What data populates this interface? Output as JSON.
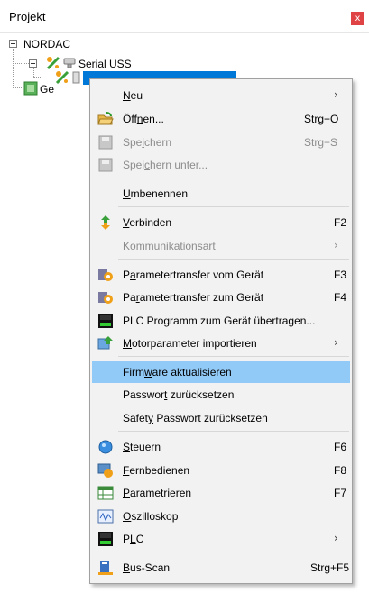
{
  "panel": {
    "title": "Projekt",
    "close_glyph": "x"
  },
  "tree": {
    "root": "NORDAC",
    "child1": "Serial USS",
    "child2": "Ge"
  },
  "menu": {
    "items": [
      {
        "pre": "",
        "u": "N",
        "post": "eu",
        "shortcut": "",
        "submenu": true,
        "disabled": false,
        "icon": ""
      },
      {
        "pre": "Öff",
        "u": "n",
        "post": "en...",
        "shortcut": "Strg+O",
        "submenu": false,
        "disabled": false,
        "icon": "folder-open-icon"
      },
      {
        "pre": "Spe",
        "u": "i",
        "post": "chern",
        "shortcut": "Strg+S",
        "submenu": false,
        "disabled": true,
        "icon": "save-icon"
      },
      {
        "pre": "Spei",
        "u": "c",
        "post": "hern unter...",
        "shortcut": "",
        "submenu": false,
        "disabled": true,
        "icon": "save-as-icon"
      },
      {
        "pre": "",
        "u": "U",
        "post": "mbenennen",
        "shortcut": "",
        "submenu": false,
        "disabled": false,
        "icon": ""
      },
      {
        "pre": "",
        "u": "V",
        "post": "erbinden",
        "shortcut": "F2",
        "submenu": false,
        "disabled": false,
        "icon": "connect-icon"
      },
      {
        "pre": "",
        "u": "K",
        "post": "ommunikationsart",
        "shortcut": "",
        "submenu": true,
        "disabled": true,
        "icon": ""
      },
      {
        "pre": "P",
        "u": "a",
        "post": "rametertransfer vom Gerät",
        "shortcut": "F3",
        "submenu": false,
        "disabled": false,
        "icon": "param-transfer-from-device-icon"
      },
      {
        "pre": "Pa",
        "u": "r",
        "post": "ametertransfer zum Gerät",
        "shortcut": "F4",
        "submenu": false,
        "disabled": false,
        "icon": "param-transfer-to-device-icon"
      },
      {
        "pre": "PLC Programm zum Gerät übertragen...",
        "u": "",
        "post": "",
        "shortcut": "",
        "submenu": false,
        "disabled": false,
        "icon": "plc-program-icon"
      },
      {
        "pre": "",
        "u": "M",
        "post": "otorparameter importieren",
        "shortcut": "",
        "submenu": true,
        "disabled": false,
        "icon": "motor-import-icon"
      },
      {
        "pre": "Firm",
        "u": "w",
        "post": "are aktualisieren",
        "shortcut": "",
        "submenu": false,
        "disabled": false,
        "icon": "",
        "hover": true
      },
      {
        "pre": "Passwor",
        "u": "t",
        "post": " zurücksetzen",
        "shortcut": "",
        "submenu": false,
        "disabled": false,
        "icon": ""
      },
      {
        "pre": "Safet",
        "u": "y",
        "post": " Passwort zurücksetzen",
        "shortcut": "",
        "submenu": false,
        "disabled": false,
        "icon": ""
      },
      {
        "pre": "",
        "u": "S",
        "post": "teuern",
        "shortcut": "F6",
        "submenu": false,
        "disabled": false,
        "icon": "control-icon"
      },
      {
        "pre": "",
        "u": "F",
        "post": "ernbedienen",
        "shortcut": "F8",
        "submenu": false,
        "disabled": false,
        "icon": "remote-control-icon"
      },
      {
        "pre": "",
        "u": "P",
        "post": "arametrieren",
        "shortcut": "F7",
        "submenu": false,
        "disabled": false,
        "icon": "parameterize-icon"
      },
      {
        "pre": "",
        "u": "O",
        "post": "szilloskop",
        "shortcut": "",
        "submenu": false,
        "disabled": false,
        "icon": "oscilloscope-icon"
      },
      {
        "pre": "P",
        "u": "L",
        "post": "C",
        "shortcut": "",
        "submenu": true,
        "disabled": false,
        "icon": "plc-icon"
      },
      {
        "pre": "",
        "u": "B",
        "post": "us-Scan",
        "shortcut": "Strg+F5",
        "submenu": false,
        "disabled": false,
        "icon": "bus-scan-icon"
      }
    ]
  }
}
